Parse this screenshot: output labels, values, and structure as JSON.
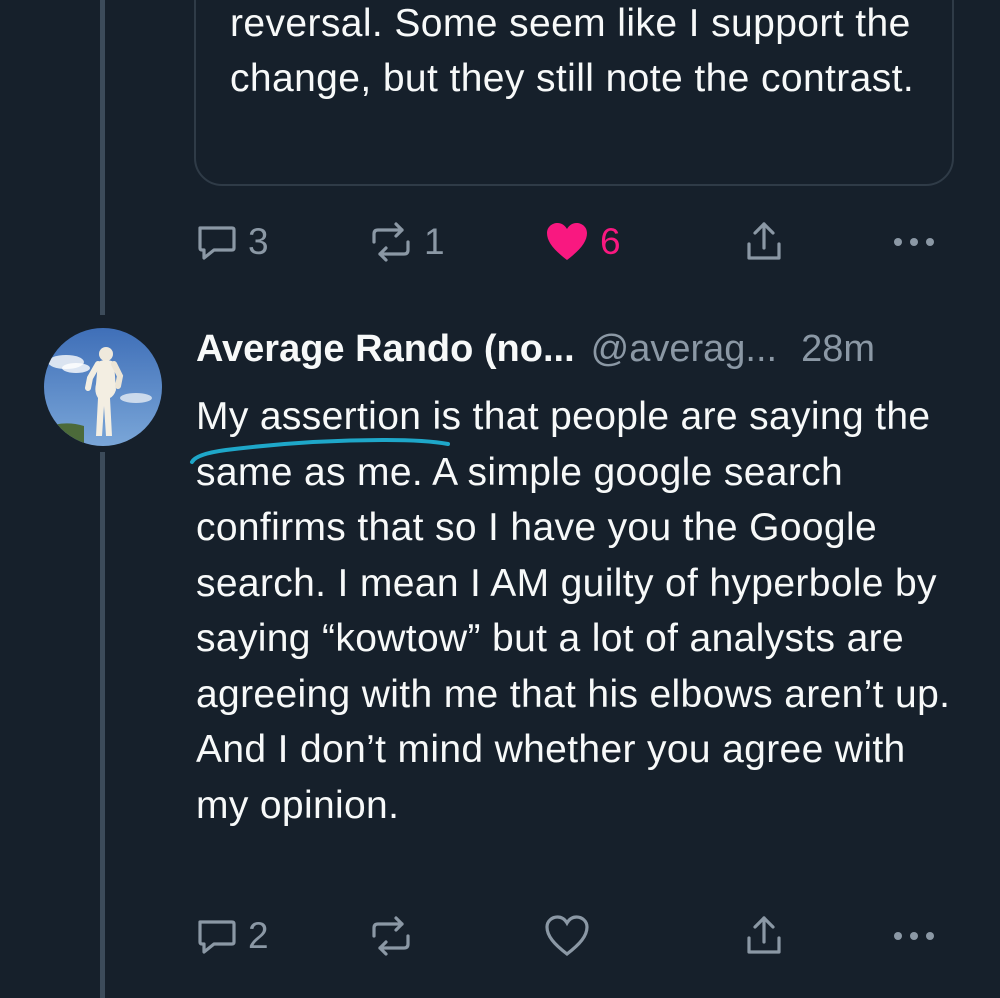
{
  "quoted_tweet": {
    "text": "reversal. Some seem like I support the change, but they still note the contrast."
  },
  "first_actions": {
    "reply_count": "3",
    "retweet_count": "1",
    "like_count": "6",
    "liked": true
  },
  "tweet": {
    "display_name": "Average Rando (no...",
    "handle": "@averag...",
    "time": "28m",
    "text": "My assertion is that people are saying the same as me. A simple google search confirms that so I have you the Google search. I mean I AM guilty of hyperbole by saying “kowtow” but a lot of analysts are agreeing with me that his elbows aren’t up. And I don’t mind whether you agree with my opinion."
  },
  "second_actions": {
    "reply_count": "2",
    "liked": false
  },
  "colors": {
    "background": "#16202b",
    "text": "#f7f9f9",
    "muted": "#8b98a5",
    "like": "#f91880",
    "annotation": "#1ea7c9"
  },
  "icons": [
    "reply-icon",
    "retweet-icon",
    "like-icon",
    "share-icon",
    "more-icon"
  ]
}
